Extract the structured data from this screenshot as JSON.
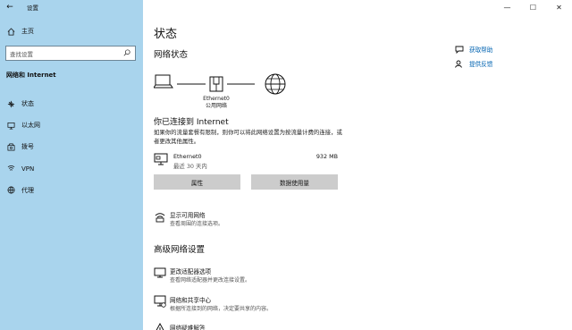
{
  "window": {
    "title": "设置",
    "back_icon": "back-arrow-icon",
    "controls": {
      "minimize": "—",
      "maximize": "☐",
      "close": "✕"
    }
  },
  "sidebar": {
    "home_label": "主页",
    "search_placeholder": "查找设置",
    "section_title": "网络和 Internet",
    "items": [
      {
        "label": "状态",
        "icon": "status-icon"
      },
      {
        "label": "以太网",
        "icon": "ethernet-icon"
      },
      {
        "label": "拨号",
        "icon": "dialup-icon"
      },
      {
        "label": "VPN",
        "icon": "vpn-icon"
      },
      {
        "label": "代理",
        "icon": "proxy-icon"
      }
    ],
    "bg_color": "#a9d4ed"
  },
  "main": {
    "title": "状态",
    "network_status_heading": "网络状态",
    "diagram": {
      "adapter_label": "Ethernet0",
      "network_label": "公用网络"
    },
    "connected_title": "你已连接到 Internet",
    "connected_desc": "如果你的流量套餐有限制，则你可以将此网络设置为按流量计费的连接，或者更改其他属性。",
    "adapter": {
      "name": "Ethernet0",
      "sub": "最近 30 天内",
      "usage": "932 MB"
    },
    "buttons": {
      "properties": "属性",
      "data_usage": "数据使用量"
    },
    "show_networks": {
      "title": "显示可用网络",
      "sub": "查看周围的连接选项。"
    },
    "advanced_heading": "高级网络设置",
    "advanced": [
      {
        "title": "更改适配器选项",
        "sub": "查看网络适配器并更改连接设置。",
        "icon": "adapter-options-icon"
      },
      {
        "title": "网络和共享中心",
        "sub": "根据所连接到的网络，决定要共享的内容。",
        "icon": "sharing-center-icon"
      },
      {
        "title": "网络疑难解答",
        "sub": "",
        "icon": "troubleshoot-icon"
      }
    ]
  },
  "help": {
    "get_help": "获取帮助",
    "feedback": "提供反馈"
  },
  "colors": {
    "accent": "#0063b1",
    "button": "#cccccc"
  }
}
